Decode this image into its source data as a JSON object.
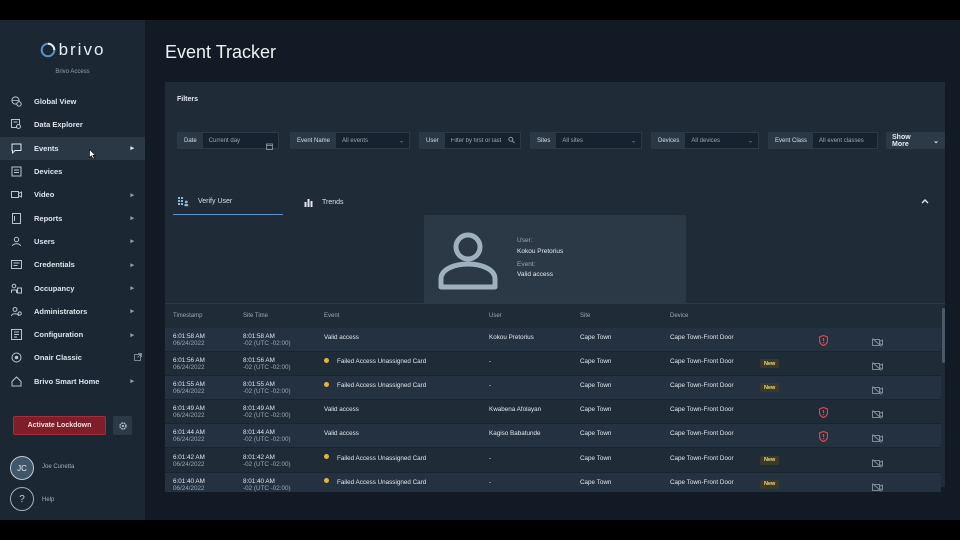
{
  "app": {
    "brand": "brivo",
    "brand_sub": "Brivo Access",
    "page_title": "Event Tracker"
  },
  "sidebar": {
    "items": [
      {
        "label": "Global View",
        "icon": "globe-icon",
        "has_chevron": false
      },
      {
        "label": "Data Explorer",
        "icon": "data-explorer-icon",
        "has_chevron": false
      },
      {
        "label": "Events",
        "icon": "chat-icon",
        "has_chevron": true
      },
      {
        "label": "Devices",
        "icon": "devices-icon",
        "has_chevron": false
      },
      {
        "label": "Video",
        "icon": "video-icon",
        "has_chevron": true
      },
      {
        "label": "Reports",
        "icon": "reports-icon",
        "has_chevron": true
      },
      {
        "label": "Users",
        "icon": "user-icon",
        "has_chevron": true
      },
      {
        "label": "Credentials",
        "icon": "credentials-icon",
        "has_chevron": true
      },
      {
        "label": "Occupancy",
        "icon": "occupancy-icon",
        "has_chevron": true
      },
      {
        "label": "Administrators",
        "icon": "admin-icon",
        "has_chevron": true
      },
      {
        "label": "Configuration",
        "icon": "configuration-icon",
        "has_chevron": true
      },
      {
        "label": "Onair Classic",
        "icon": "onair-icon",
        "has_chevron": false,
        "external": true
      },
      {
        "label": "Brivo Smart Home",
        "icon": "home-icon",
        "has_chevron": true
      }
    ],
    "active_index": 2,
    "lockdown_label": "Activate Lockdown",
    "user_initials": "JC",
    "user_name": "Joe Cunetta",
    "help_label": "Help",
    "help_glyph": "?"
  },
  "filters": {
    "title": "Filters",
    "date": {
      "label": "Date",
      "placeholder": "Current day"
    },
    "event_name": {
      "label": "Event Name",
      "value": "All events"
    },
    "user": {
      "label": "User",
      "placeholder": "Filter by first or last"
    },
    "sites": {
      "label": "Sites",
      "value": "All sites"
    },
    "devices": {
      "label": "Devices",
      "value": "All devices"
    },
    "event_class": {
      "label": "Event Class",
      "value": "All event classes"
    },
    "show_more": "Show More"
  },
  "tabs": [
    {
      "label": "Verify User",
      "icon": "grid-user-icon",
      "active": true
    },
    {
      "label": "Trends",
      "icon": "bar-chart-icon",
      "active": false
    }
  ],
  "verify_user": {
    "user_key": "User:",
    "user_value": "Kokou Pretorius",
    "event_key": "Event:",
    "event_value": "Valid access"
  },
  "table": {
    "columns": [
      "Timestamp",
      "Site Time",
      "Event",
      "User",
      "Site",
      "Device"
    ],
    "rows": [
      {
        "time": "6:01:58 AM",
        "date": "06/24/2022",
        "site_time": "8:01:58 AM",
        "tz": "-02 (UTC -02:00)",
        "event": "Valid access",
        "failed": false,
        "user": "Kokou Pretorius",
        "site": "Cape Town",
        "device": "Cape Town-Front Door",
        "new": false,
        "alert": true
      },
      {
        "time": "6:01:56 AM",
        "date": "06/24/2022",
        "site_time": "8:01:56 AM",
        "tz": "-02 (UTC -02:00)",
        "event": "Failed Access Unassigned Card",
        "failed": true,
        "user": "-",
        "site": "Cape Town",
        "device": "Cape Town-Front Door",
        "new": true,
        "alert": false
      },
      {
        "time": "6:01:55 AM",
        "date": "06/24/2022",
        "site_time": "8:01:55 AM",
        "tz": "-02 (UTC -02:00)",
        "event": "Failed Access Unassigned Card",
        "failed": true,
        "user": "-",
        "site": "Cape Town",
        "device": "Cape Town-Front Door",
        "new": true,
        "alert": false
      },
      {
        "time": "6:01:49 AM",
        "date": "06/24/2022",
        "site_time": "8:01:49 AM",
        "tz": "-02 (UTC -02:00)",
        "event": "Valid access",
        "failed": false,
        "user": "Kwabena Afolayan",
        "site": "Cape Town",
        "device": "Cape Town-Front Door",
        "new": false,
        "alert": true
      },
      {
        "time": "6:01:44 AM",
        "date": "06/24/2022",
        "site_time": "8:01:44 AM",
        "tz": "-02 (UTC -02:00)",
        "event": "Valid access",
        "failed": false,
        "user": "Kagiso Babatunde",
        "site": "Cape Town",
        "device": "Cape Town-Front Door",
        "new": false,
        "alert": true
      },
      {
        "time": "6:01:42 AM",
        "date": "06/24/2022",
        "site_time": "8:01:42 AM",
        "tz": "-02 (UTC -02:00)",
        "event": "Failed Access Unassigned Card",
        "failed": true,
        "user": "-",
        "site": "Cape Town",
        "device": "Cape Town-Front Door",
        "new": true,
        "alert": false
      },
      {
        "time": "6:01:40 AM",
        "date": "06/24/2022",
        "site_time": "8:01:40 AM",
        "tz": "-02 (UTC -02:00)",
        "event": "Failed Access Unassigned Card",
        "failed": true,
        "user": "-",
        "site": "Cape Town",
        "device": "Cape Town-Front Door",
        "new": true,
        "alert": false
      }
    ],
    "new_label": "New"
  },
  "colors": {
    "accent": "#5a93c7",
    "lockdown": "#7d1e28",
    "alert": "#e0454f",
    "warning_dot": "#e1b53b"
  }
}
